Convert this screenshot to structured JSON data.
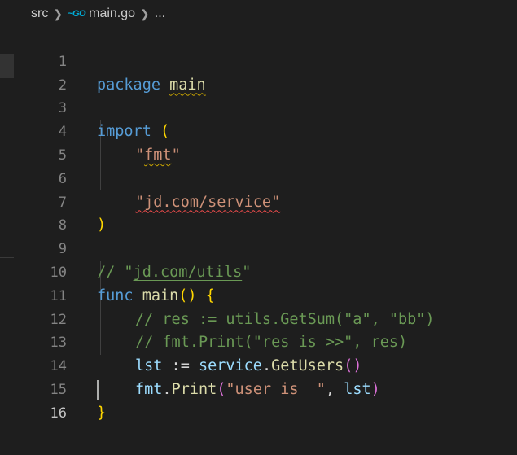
{
  "breadcrumb": {
    "folder": "src",
    "file": "main.go",
    "file_icon": "go-file-icon",
    "more": "..."
  },
  "editor": {
    "language": "go",
    "current_line": 16,
    "lines": [
      {
        "n": "1"
      },
      {
        "n": "2"
      },
      {
        "n": "3"
      },
      {
        "n": "4"
      },
      {
        "n": "5"
      },
      {
        "n": "6"
      },
      {
        "n": "7"
      },
      {
        "n": "8"
      },
      {
        "n": "9"
      },
      {
        "n": "10"
      },
      {
        "n": "11"
      },
      {
        "n": "12"
      },
      {
        "n": "13"
      },
      {
        "n": "14"
      },
      {
        "n": "15"
      },
      {
        "n": "16"
      }
    ],
    "tokens": {
      "l1_kw": "package",
      "l1_name": "main",
      "l3_kw": "import",
      "l3_paren": "(",
      "l4_q1": "\"",
      "l4_fmt": "fmt",
      "l4_q2": "\"",
      "l6_str": "\"jd.com/service\"",
      "l7_paren": ")",
      "l9_comment_a": "// \"",
      "l9_comment_link": "jd.com/utils",
      "l9_comment_b": "\"",
      "l10_kw": "func",
      "l10_fn": "main",
      "l10_parens": "()",
      "l10_brace": "{",
      "l11_comment": "// res := utils.GetSum(\"a\", \"bb\")",
      "l12_comment": "// fmt.Print(\"res is >>\", res)",
      "l13_var": "lst",
      "l13_op": " := ",
      "l13_pkg": "service",
      "l13_dot": ".",
      "l13_fn": "GetUsers",
      "l13_parens": "()",
      "l14_pkg": "fmt",
      "l14_dot": ".",
      "l14_fn": "Print",
      "l14_open": "(",
      "l14_str": "\"user is  \"",
      "l14_comma": ", ",
      "l14_var": "lst",
      "l14_close": ")",
      "l15_brace": "}"
    }
  },
  "colors": {
    "background": "#1e1e1e",
    "keyword": "#569cd6",
    "function": "#dcdcaa",
    "string": "#ce9178",
    "variable": "#9cdcfe",
    "comment": "#6a9955",
    "bracket_gold": "#ffd700",
    "bracket_orchid": "#da70d6",
    "warning_squiggle": "#cca700",
    "error_squiggle": "#f14c4c",
    "go_icon": "#00acd7"
  }
}
